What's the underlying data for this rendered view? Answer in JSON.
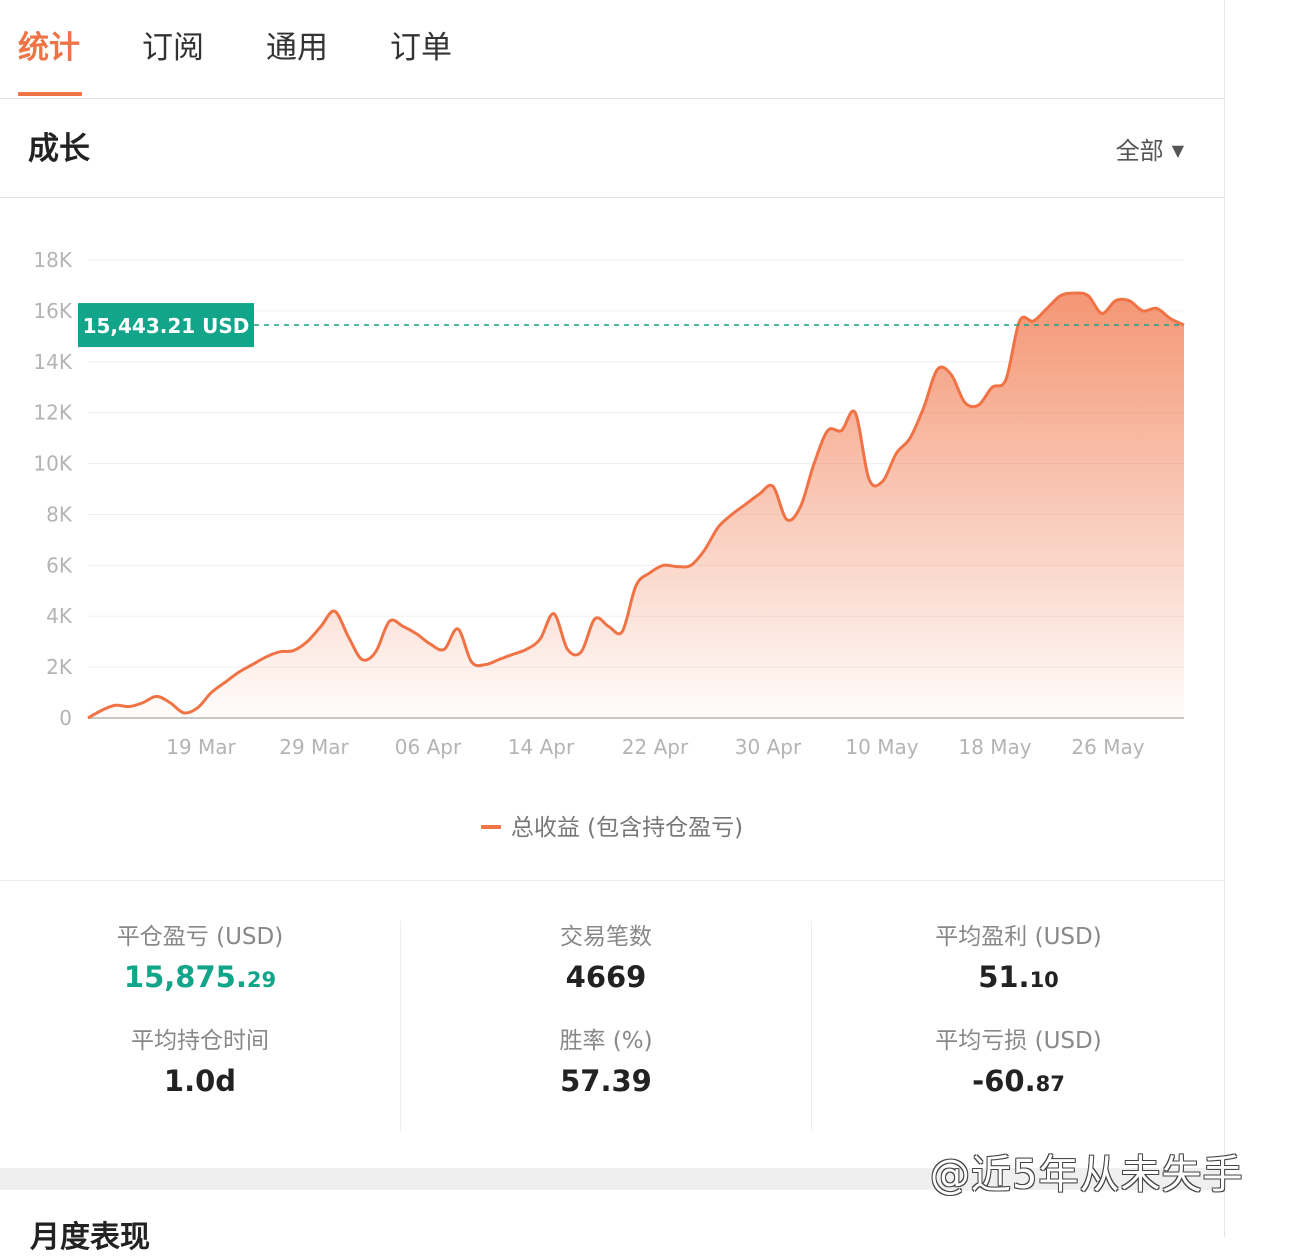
{
  "tabs": [
    {
      "label": "统计",
      "active": true
    },
    {
      "label": "订阅",
      "active": false
    },
    {
      "label": "通用",
      "active": false
    },
    {
      "label": "订单",
      "active": false
    }
  ],
  "section": {
    "title": "成长",
    "range_label": "全部"
  },
  "chart_data": {
    "type": "area",
    "title": "",
    "current_label": "15,443.21 USD",
    "current_value": 15443.21,
    "y_ticks": [
      "0",
      "2K",
      "4K",
      "6K",
      "8K",
      "10K",
      "12K",
      "14K",
      "16K",
      "18K"
    ],
    "x_ticks": [
      "19 Mar",
      "29 Mar",
      "06 Apr",
      "14 Apr",
      "22 Apr",
      "30 Apr",
      "10 May",
      "18 May",
      "26 May"
    ],
    "ylim": [
      0,
      18000
    ],
    "grid": true,
    "legend_position": "bottom-center",
    "series": [
      {
        "name": "总收益 (包含持仓盈亏)",
        "color": "#f07346",
        "values": [
          0,
          300,
          500,
          450,
          600,
          850,
          600,
          200,
          400,
          1000,
          1400,
          1800,
          2100,
          2400,
          2600,
          2650,
          3000,
          3600,
          4200,
          3200,
          2300,
          2600,
          3800,
          3600,
          3300,
          2900,
          2700,
          3500,
          2200,
          2100,
          2300,
          2500,
          2700,
          3100,
          4100,
          2700,
          2600,
          3900,
          3600,
          3400,
          5200,
          5700,
          6000,
          5950,
          6000,
          6600,
          7500,
          8000,
          8400,
          8800,
          9100,
          7800,
          8300,
          10000,
          11300,
          11300,
          12000,
          9400,
          9300,
          10400,
          11000,
          12200,
          13700,
          13500,
          12400,
          12300,
          13000,
          13300,
          15600,
          15600,
          16100,
          16600,
          16700,
          16600,
          15900,
          16400,
          16400,
          16000,
          16100,
          15700,
          15443
        ]
      }
    ]
  },
  "stats": {
    "closed_pnl": {
      "label": "平仓盈亏 (USD)",
      "int": "15,875.",
      "dec": "29"
    },
    "trades": {
      "label": "交易笔数",
      "value": "4669"
    },
    "avg_profit": {
      "label": "平均盈利 (USD)",
      "int": "51.",
      "dec": "10"
    },
    "avg_hold": {
      "label": "平均持仓时间",
      "value": "1.0d"
    },
    "win_rate": {
      "label": "胜率 (%)",
      "value": "57.39"
    },
    "avg_loss": {
      "label": "平均亏损 (USD)",
      "int": "-60.",
      "dec": "87"
    }
  },
  "next_section": {
    "title": "月度表现"
  },
  "watermark": "@近5年从未失手",
  "colors": {
    "accent": "#f07346",
    "positive": "#12a58a",
    "label_bg": "#12a58a"
  }
}
